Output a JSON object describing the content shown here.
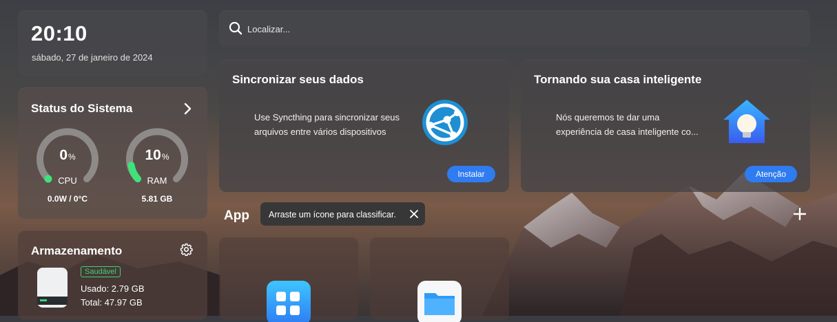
{
  "clock": {
    "time": "20:10",
    "date": "sábado, 27 de janeiro de 2024"
  },
  "system_status": {
    "title": "Status do Sistema",
    "cpu": {
      "value": "0",
      "unit": "%",
      "label": "CPU",
      "detail": "0.0W / 0°C",
      "level": 0
    },
    "ram": {
      "value": "10",
      "unit": "%",
      "label": "RAM",
      "detail": "5.81 GB",
      "level": 10
    },
    "accent_color": "#3ee27a"
  },
  "storage": {
    "title": "Armazenamento",
    "health": "Saudável",
    "used": "Usado: 2.79 GB",
    "total": "Total: 47.97 GB"
  },
  "search": {
    "placeholder": "Localizar..."
  },
  "sync_card": {
    "title": "Sincronizar seus dados",
    "description_line1": "Use Syncthing para sincronizar seus",
    "description_line2": "arquivos entre vários dispositivos",
    "button": "Instalar"
  },
  "home_card": {
    "title": "Tornando sua casa inteligente",
    "description_line1": "Nós queremos te dar uma",
    "description_line2": "experiência de casa inteligente co...",
    "button": "Atenção"
  },
  "apps": {
    "label": "App",
    "tooltip": "Arraste um ícone para classificar."
  },
  "colors": {
    "button": "#2f7bf0",
    "healthy": "#3fd17a"
  }
}
